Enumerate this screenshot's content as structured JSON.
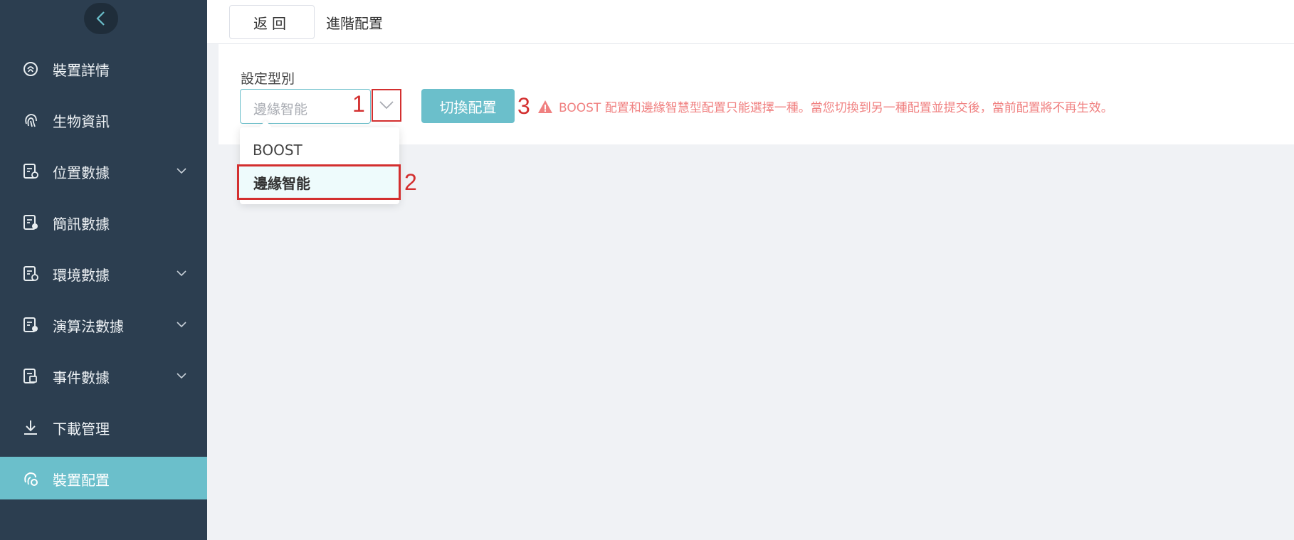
{
  "sidebar": {
    "items": [
      {
        "label": "裝置詳情",
        "icon": "fingerprint-chip-icon",
        "has_children": false,
        "active": false
      },
      {
        "label": "生物資訊",
        "icon": "fingerprint-icon",
        "has_children": false,
        "active": false
      },
      {
        "label": "位置數據",
        "icon": "document-location-icon",
        "has_children": true,
        "active": false
      },
      {
        "label": "簡訊數據",
        "icon": "document-message-icon",
        "has_children": false,
        "active": false
      },
      {
        "label": "環境數據",
        "icon": "document-environment-icon",
        "has_children": true,
        "active": false
      },
      {
        "label": "演算法數據",
        "icon": "document-algorithm-icon",
        "has_children": true,
        "active": false
      },
      {
        "label": "事件數據",
        "icon": "document-event-icon",
        "has_children": true,
        "active": false
      },
      {
        "label": "下載管理",
        "icon": "download-icon",
        "has_children": false,
        "active": false
      },
      {
        "label": "裝置配置",
        "icon": "device-settings-icon",
        "has_children": false,
        "active": true
      }
    ]
  },
  "header": {
    "back_label": "返回",
    "title": "進階配置"
  },
  "form": {
    "field_label": "設定型別",
    "select_value": "邊緣智能",
    "options": [
      "BOOST",
      "邊緣智能"
    ],
    "selected_option": "邊緣智能",
    "switch_label": "切換配置",
    "warning": "BOOST 配置和邊緣智慧型配置只能選擇一種。當您切換到另一種配置並提交後，當前配置將不再生效。"
  },
  "annotations": {
    "one": "1",
    "two": "2",
    "three": "3"
  },
  "colors": {
    "sidebar_bg": "#2c3e50",
    "accent": "#6bbfcb",
    "warning": "#f08080",
    "annotation": "#d32f2f"
  }
}
